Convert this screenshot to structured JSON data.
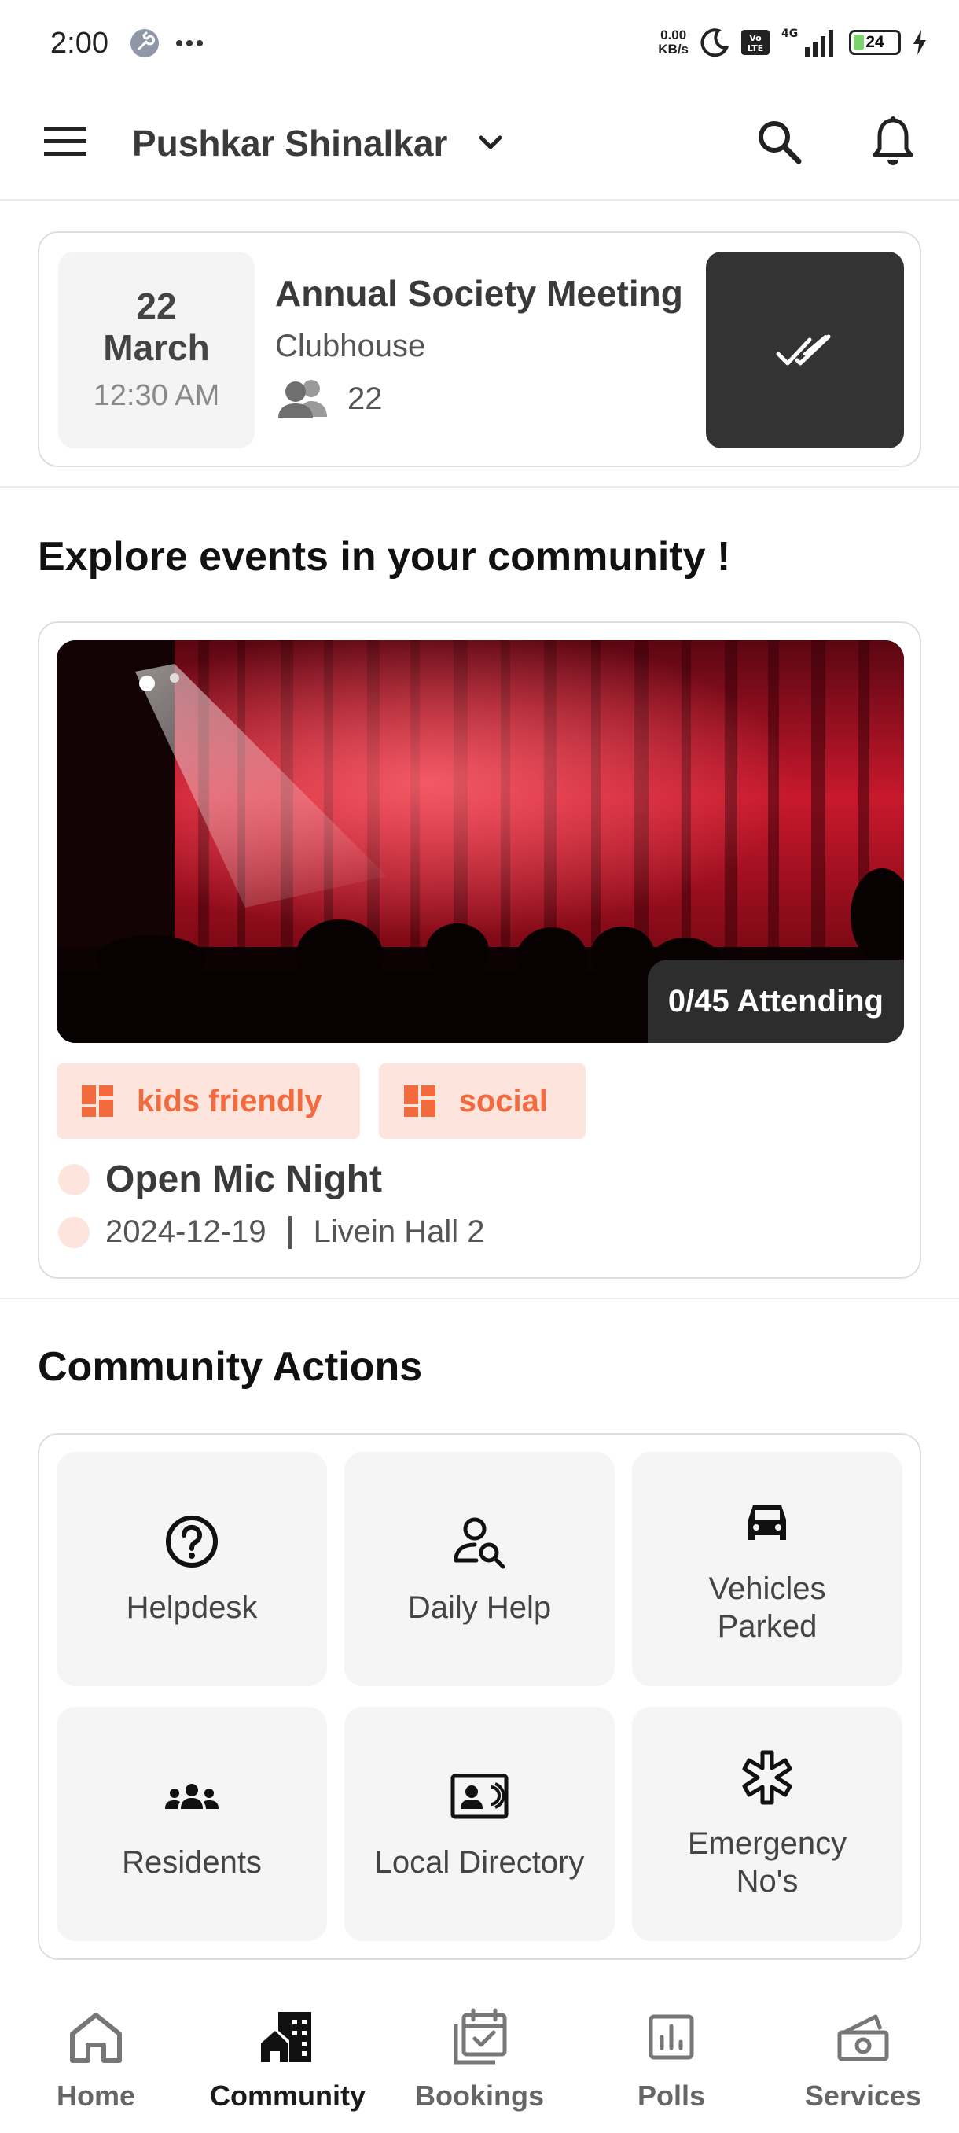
{
  "status_bar": {
    "time": "2:00",
    "net_speed_value": "0.00",
    "net_speed_unit": "KB/s",
    "battery": "24",
    "battery_level": 0.24
  },
  "header": {
    "title": "Pushkar Shinalkar"
  },
  "meeting": {
    "day": "22",
    "month": "March",
    "time": "12:30 AM",
    "title": "Annual Society Meeting",
    "venue": "Clubhouse",
    "attendees": "22"
  },
  "events_section": {
    "title": "Explore events in your community !"
  },
  "event": {
    "attending": "0/45 Attending",
    "tags": [
      "kids friendly",
      "social"
    ],
    "title": "Open Mic Night",
    "date": "2024-12-19",
    "location": "Livein Hall 2"
  },
  "actions_section": {
    "title": "Community Actions",
    "items": [
      {
        "label": "Helpdesk",
        "icon": "help-circle-icon"
      },
      {
        "label": "Daily Help",
        "icon": "person-search-icon"
      },
      {
        "label": "Vehicles\nParked",
        "icon": "car-icon"
      },
      {
        "label": "Residents",
        "icon": "group-icon"
      },
      {
        "label": "Local Directory",
        "icon": "contact-card-icon"
      },
      {
        "label": "Emergency\nNo's",
        "icon": "medical-asterisk-icon"
      }
    ]
  },
  "bottom_nav": {
    "items": [
      {
        "label": "Home",
        "icon": "home-icon"
      },
      {
        "label": "Community",
        "icon": "community-icon",
        "active": true
      },
      {
        "label": "Bookings",
        "icon": "calendar-check-icon"
      },
      {
        "label": "Polls",
        "icon": "poll-icon"
      },
      {
        "label": "Services",
        "icon": "services-icon"
      }
    ]
  },
  "colors": {
    "accent": "#f36a3c",
    "tag_bg": "#fde4dc",
    "dark_button": "#333333",
    "tile_bg": "#f5f5f5"
  }
}
